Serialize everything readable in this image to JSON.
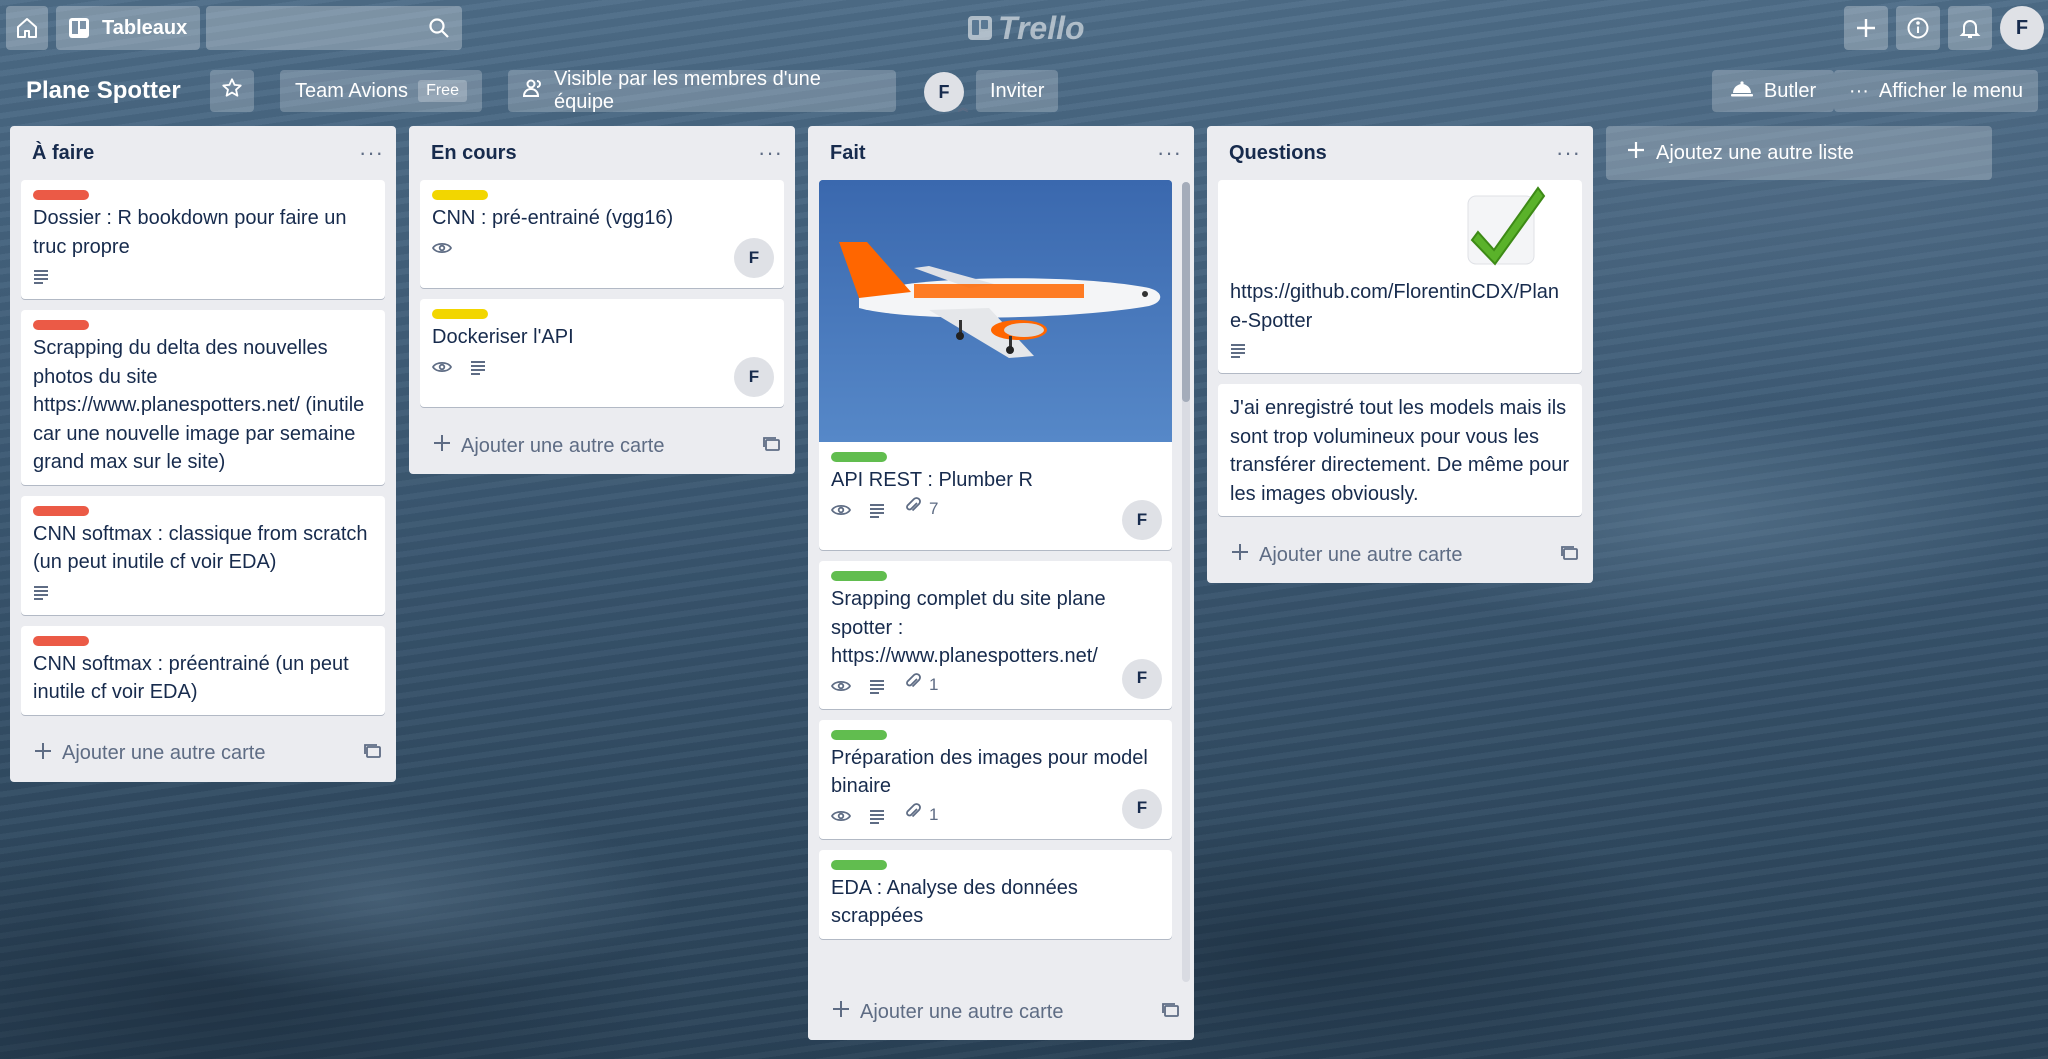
{
  "header": {
    "boards_label": "Tableaux",
    "logo_text": "Trello",
    "user_initial": "F"
  },
  "board": {
    "title": "Plane Spotter",
    "team_name": "Team Avions",
    "team_plan": "Free",
    "visibility": "Visible par les membres d'une équipe",
    "member_initial": "F",
    "invite_label": "Inviter",
    "butler_label": "Butler",
    "menu_label": "Afficher le menu",
    "add_list_label": "Ajoutez une autre liste"
  },
  "lists": [
    {
      "title": "À faire",
      "menu": "···",
      "add_card_label": "Ajouter une autre carte",
      "cards": [
        {
          "label_color": "red",
          "text": "Dossier : R bookdown pour faire un truc propre"
        },
        {
          "label_color": "red",
          "text": "Scrapping du delta des nouvelles photos du site https://www.planespotters.net/ (inutile car une nouvelle image par semaine grand max sur le site)"
        },
        {
          "label_color": "red",
          "text": "CNN softmax : classique from scratch (un peut inutile cf voir EDA)"
        },
        {
          "label_color": "red",
          "text": "CNN softmax : préentrainé (un peut inutile cf voir EDA)"
        }
      ]
    },
    {
      "title": "En cours",
      "menu": "···",
      "add_card_label": "Ajouter une autre carte",
      "cards": [
        {
          "label_color": "yellow",
          "text": "CNN : pré-entrainé (vgg16)",
          "member": "F"
        },
        {
          "label_color": "yellow",
          "text": "Dockeriser l'API",
          "member": "F"
        }
      ]
    },
    {
      "title": "Fait",
      "menu": "···",
      "add_card_label": "Ajouter une autre carte",
      "cards": [
        {
          "label_color": "green",
          "text": "API REST : Plumber R",
          "attachments": "7",
          "member": "F"
        },
        {
          "label_color": "green",
          "text": "Srapping complet du site plane spotter : https://www.planespotters.net/",
          "attachments": "1",
          "member": "F"
        },
        {
          "label_color": "green",
          "text": "Préparation des images pour model binaire",
          "attachments": "1",
          "member": "F"
        },
        {
          "label_color": "green",
          "text": "EDA : Analyse des données scrappées"
        }
      ]
    },
    {
      "title": "Questions",
      "menu": "···",
      "add_card_label": "Ajouter une autre carte",
      "cards": [
        {
          "text": "https://github.com/FlorentinCDX/Plane-Spotter"
        },
        {
          "text": "J'ai enregistré tout les models mais ils sont trop volumineux pour vous les transférer directement. De même pour les images obviously."
        }
      ]
    }
  ],
  "colors": {
    "label_red": "#eb5a46",
    "label_yellow": "#f2d600",
    "label_green": "#61bd4f",
    "list_bg": "#ebecf0"
  }
}
